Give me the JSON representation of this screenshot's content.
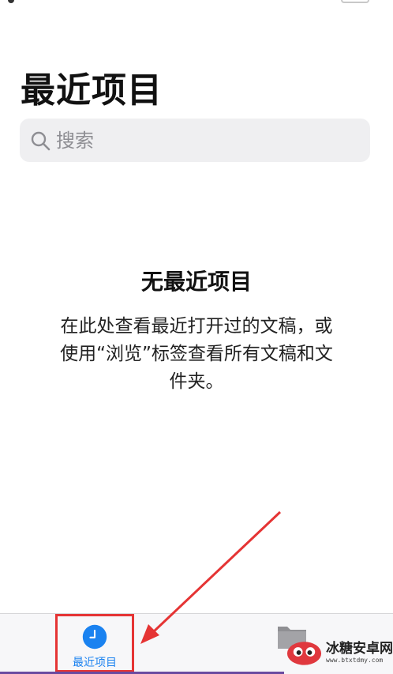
{
  "header": {
    "title": "最近项目"
  },
  "search": {
    "placeholder": "搜索"
  },
  "empty_state": {
    "title": "无最近项目",
    "description": "在此处查看最近打开过的文稿，或使用“浏览”标签查看所有文稿和文件夹。"
  },
  "tab_bar": {
    "recents_label": "最近项目"
  },
  "watermark": {
    "name": "冰糖安卓网",
    "url": "www.btxtdmy.com"
  },
  "colors": {
    "accent": "#1a82f0",
    "highlight": "#e53434"
  }
}
